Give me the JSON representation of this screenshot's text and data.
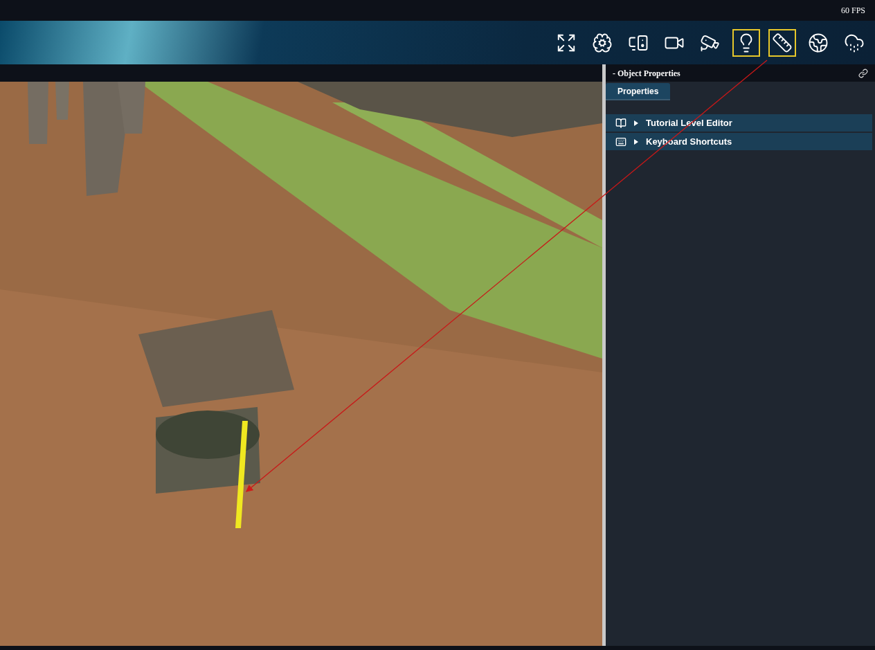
{
  "status_bar": {
    "fps": "60 FPS"
  },
  "toolbar": {
    "buttons": [
      {
        "selected": false
      },
      {
        "selected": false
      },
      {
        "selected": false
      },
      {
        "selected": false
      },
      {
        "selected": false
      },
      {
        "selected": true
      },
      {
        "selected": true
      },
      {
        "selected": false
      },
      {
        "selected": false
      }
    ]
  },
  "panel": {
    "title": "- Object Properties",
    "tabs": [
      {
        "label": "Properties",
        "selected": true
      }
    ],
    "items": [
      {
        "label": "Tutorial Level Editor",
        "expanded": false
      },
      {
        "label": "Keyboard Shortcuts",
        "expanded": false
      }
    ]
  },
  "annotation": {
    "kind": "arrow"
  }
}
